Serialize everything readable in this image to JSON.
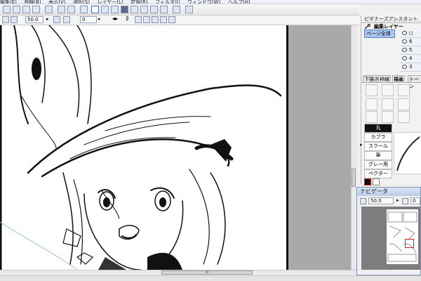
{
  "menubar": {
    "items": [
      "編集(E)",
      "枠線(B)",
      "表示(V)",
      "選択(S)",
      "レイヤー(L)",
      "定規(R)",
      "フィルタ(I)",
      "ウィンドウ(W)",
      "ヘルプ(H)"
    ]
  },
  "toolbar2": {
    "zoom_value": "50.0",
    "rotate_value": "0"
  },
  "assistant_panel": {
    "title": "ピギナーズアシスタント",
    "edit_layer_label": "編集レイヤー",
    "page_all_label": "ページ全体",
    "layer_numbers": [
      "6",
      "5",
      "4",
      "3"
    ]
  },
  "tool_tabs": [
    "下描き",
    "枠線",
    "描画",
    "トーン"
  ],
  "brushes": [
    "丸",
    "カブラ",
    "スクール",
    "筆",
    "グレー用",
    "ペクター"
  ],
  "navigator": {
    "title": "ナビゲータ",
    "zoom_value": "50.0",
    "rotate_value": "0"
  },
  "colors": {
    "page_border": "#111111",
    "canvas_bg": "#a9a9a9",
    "nav_highlight": "#e02020",
    "selection_blue": "#a8c6f0"
  }
}
